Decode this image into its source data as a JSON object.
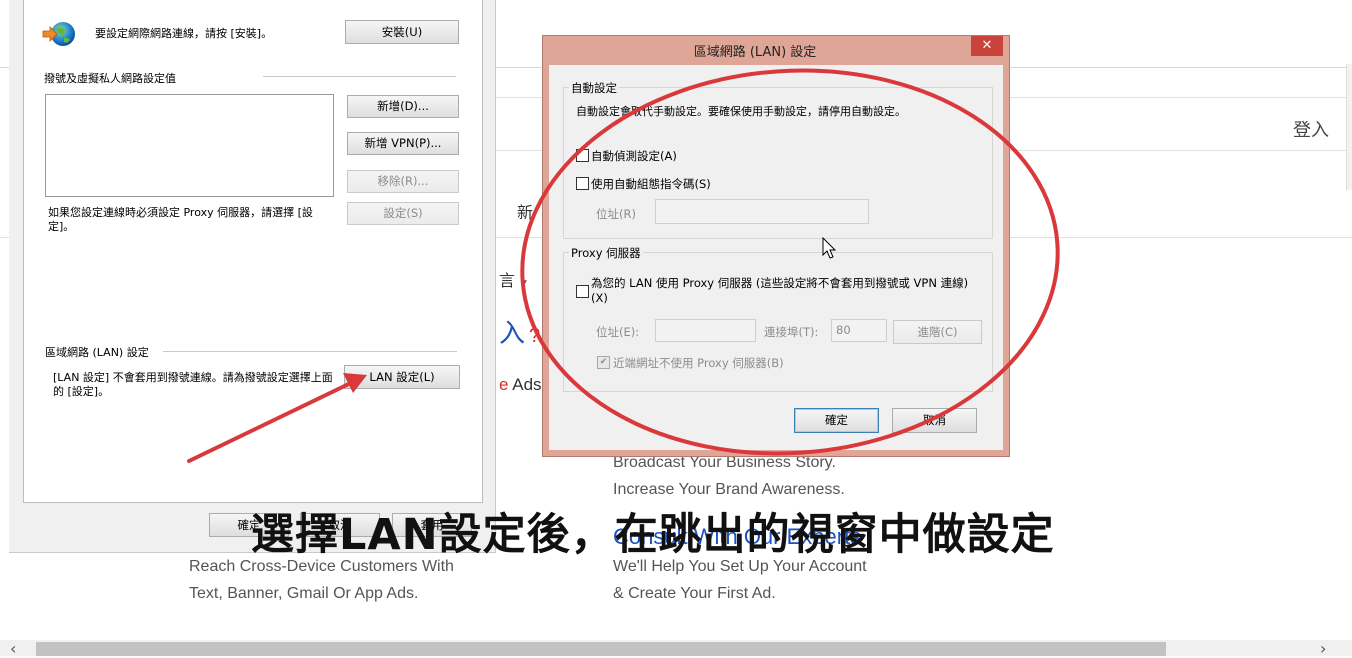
{
  "background_page": {
    "login": "登入",
    "frag_nav": "新",
    "frag_language": "言",
    "frag_signin": "入",
    "frag_signin_icon": "?",
    "frag_ads_prefix": "e",
    "frag_ads": " Ads",
    "col1_line1": "Broadcast Your Business Story.",
    "col1_line2": "Increase Your Brand Awareness.",
    "consult_link": "Consult With Our Experts",
    "col2_line1": "Reach Cross-Device Customers With",
    "col2_line2": "Text, Banner, Gmail Or App Ads.",
    "col3_line1": "We'll Help You Set Up Your Account",
    "col3_line2": "& Create Your First Ad.",
    "scroll_left": "‹",
    "scroll_right": "›"
  },
  "internet_options": {
    "setup_text": "要設定網際網路連線，請按 [安裝]。",
    "install_button": "安裝(U)",
    "dialup_heading": "撥號及虛擬私人網路設定值",
    "add_button": "新增(D)...",
    "add_vpn_button": "新增 VPN(P)...",
    "remove_button": "移除(R)...",
    "settings_button": "設定(S)",
    "proxy_note": "如果您設定連線時必須設定 Proxy 伺服器，請選擇 [設定]。",
    "lan_heading": "區域網路 (LAN) 設定",
    "lan_note": "[LAN 設定] 不會套用到撥號連線。請為撥號設定選擇上面的 [設定]。",
    "lan_button": "LAN 設定(L)",
    "ok_button": "確定",
    "cancel_button": "取消",
    "apply_button": "套用"
  },
  "lan_dialog": {
    "title": "區域網路 (LAN) 設定",
    "close_glyph": "✕",
    "auto_config_legend": "自動設定",
    "auto_config_desc": "自動設定會取代手動設定。要確保使用手動設定，請停用自動設定。",
    "auto_detect_label": "自動偵測設定(A)",
    "auto_detect_checked": false,
    "script_label": "使用自動組態指令碼(S)",
    "script_checked": false,
    "address_label": "位址(R)",
    "address_value": "",
    "proxy_legend": "Proxy 伺服器",
    "proxy_label": "為您的 LAN 使用 Proxy 伺服器 (這些設定將不會套用到撥號或 VPN 連線)(X)",
    "proxy_checked": false,
    "proxy_address_label": "位址(E):",
    "proxy_address_value": "",
    "port_label": "連接埠(T):",
    "port_value": "80",
    "advanced_button": "進階(C)",
    "bypass_label": "近端網址不使用 Proxy 伺服器(B)",
    "bypass_checked": true,
    "bypass_glyph": "✔",
    "ok_button": "確定",
    "cancel_button": "取消"
  },
  "annotation": {
    "caption": "選擇LAN設定後，在跳出的視窗中做設定",
    "arrow_color": "#d9393b",
    "circle_color": "#d9393b"
  }
}
